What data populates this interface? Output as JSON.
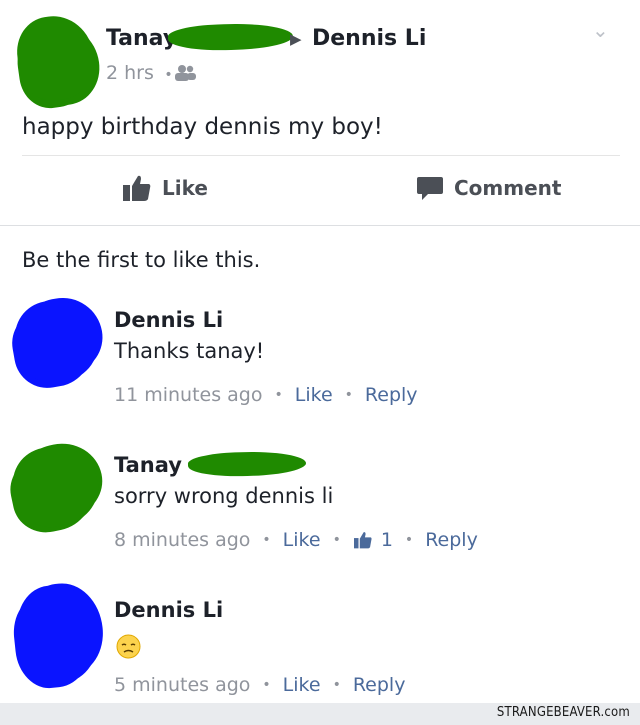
{
  "post": {
    "author": "Tanay",
    "recipient": "Dennis Li",
    "time": "2 hrs",
    "privacy_icon": "friends-icon",
    "text": "happy birthday dennis my boy!",
    "like_label": "Like",
    "comment_label": "Comment",
    "menu_icon": "chevron-down-icon"
  },
  "likes_summary": "Be the first to like this.",
  "comments": [
    {
      "author": "Dennis Li",
      "text": "Thanks tanay!",
      "time": "11 minutes ago",
      "like": "Like",
      "reply": "Reply"
    },
    {
      "author": "Tanay",
      "text": "sorry wrong dennis li",
      "time": "8 minutes ago",
      "like": "Like",
      "like_count": "1",
      "reply": "Reply"
    },
    {
      "author": "Dennis Li",
      "text": "disappointed-face-emoji",
      "time": "5 minutes ago",
      "like": "Like",
      "reply": "Reply"
    }
  ],
  "watermark": "STRANGEBEAVER.com",
  "colors": {
    "scribble_green": "#1f8a00",
    "scribble_blue": "#0a14ff",
    "link": "#4b6a9b",
    "meta": "#90949c"
  }
}
